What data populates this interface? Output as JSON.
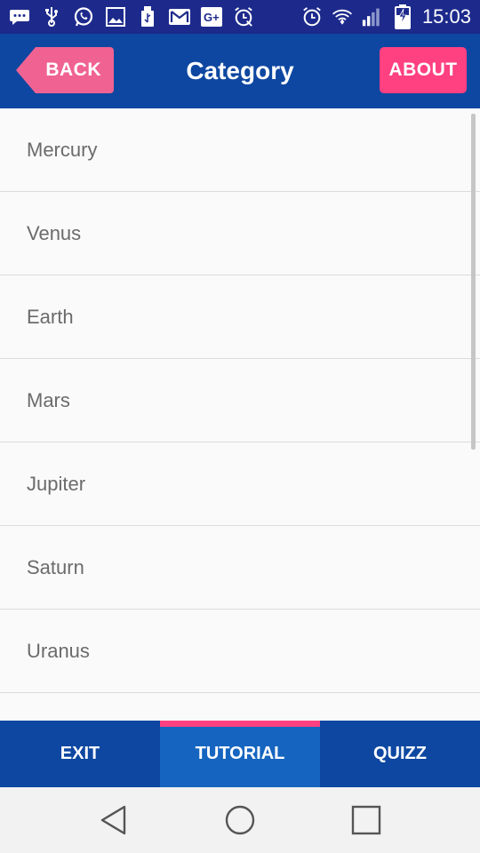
{
  "status_bar": {
    "time": "15:03",
    "icons": [
      "chat-icon",
      "usb-icon",
      "whatsapp-icon",
      "image-icon",
      "usb-storage-icon",
      "gmail-icon",
      "google-plus-icon",
      "alarm-off-icon",
      "alarm-icon",
      "wifi-icon",
      "signal-icon",
      "battery-charging-icon"
    ]
  },
  "app_bar": {
    "back_label": "BACK",
    "title": "Category",
    "about_label": "ABOUT"
  },
  "list": {
    "items": [
      "Mercury",
      "Venus",
      "Earth",
      "Mars",
      "Jupiter",
      "Saturn",
      "Uranus",
      ""
    ]
  },
  "tabs": {
    "items": [
      {
        "label": "EXIT",
        "active": false
      },
      {
        "label": "TUTORIAL",
        "active": true
      },
      {
        "label": "QUIZZ",
        "active": false
      }
    ]
  },
  "nav_bar": {
    "icons": [
      "back-triangle-icon",
      "home-circle-icon",
      "recents-square-icon"
    ]
  },
  "colors": {
    "status_bar": "#1d2a8c",
    "app_bar": "#0d47a1",
    "back_button": "#f06292",
    "about_button": "#ff4081",
    "active_tab": "#1565c0",
    "tab_indicator": "#ff4081"
  }
}
